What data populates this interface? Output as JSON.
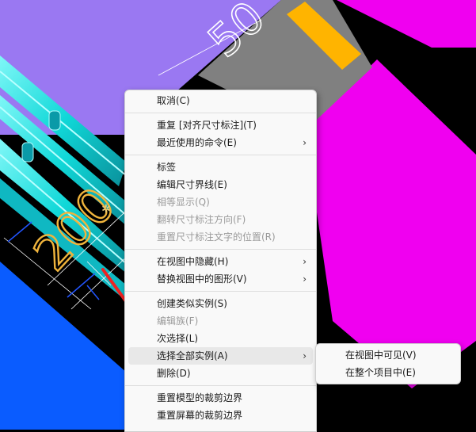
{
  "canvas": {
    "dimension_top": "50",
    "dimension_left": "200"
  },
  "colors": {
    "purple": "#9a78f2",
    "magenta": "#f000f0",
    "blue": "#0a5cff",
    "cyan": "#19e0e0",
    "orange": "#ffb400",
    "gray": "#808080",
    "dim_gold": "#f0b43c",
    "arrow_red": "#ee2222"
  },
  "context_menu": {
    "groups": [
      [
        {
          "label": "取消(C)",
          "enabled": true
        }
      ],
      [
        {
          "label": "重复 [对齐尺寸标注](T)",
          "enabled": true
        },
        {
          "label": "最近使用的命令(E)",
          "enabled": true,
          "submenu": true
        }
      ],
      [
        {
          "label": "标签",
          "enabled": true
        },
        {
          "label": "编辑尺寸界线(E)",
          "enabled": true
        },
        {
          "label": "相等显示(Q)",
          "enabled": false
        },
        {
          "label": "翻转尺寸标注方向(F)",
          "enabled": false
        },
        {
          "label": "重置尺寸标注文字的位置(R)",
          "enabled": false
        }
      ],
      [
        {
          "label": "在视图中隐藏(H)",
          "enabled": true,
          "submenu": true
        },
        {
          "label": "替换视图中的图形(V)",
          "enabled": true,
          "submenu": true
        }
      ],
      [
        {
          "label": "创建类似实例(S)",
          "enabled": true
        },
        {
          "label": "编辑族(F)",
          "enabled": false
        },
        {
          "label": "次选择(L)",
          "enabled": true
        },
        {
          "label": "选择全部实例(A)",
          "enabled": true,
          "submenu": true,
          "highlighted": true
        },
        {
          "label": "删除(D)",
          "enabled": true
        }
      ],
      [
        {
          "label": "重置模型的裁剪边界",
          "enabled": true
        },
        {
          "label": "重置屏幕的裁剪边界",
          "enabled": true
        }
      ]
    ]
  },
  "sub_menu": {
    "items": [
      {
        "label": "在视图中可见(V)"
      },
      {
        "label": "在整个项目中(E)"
      }
    ]
  }
}
